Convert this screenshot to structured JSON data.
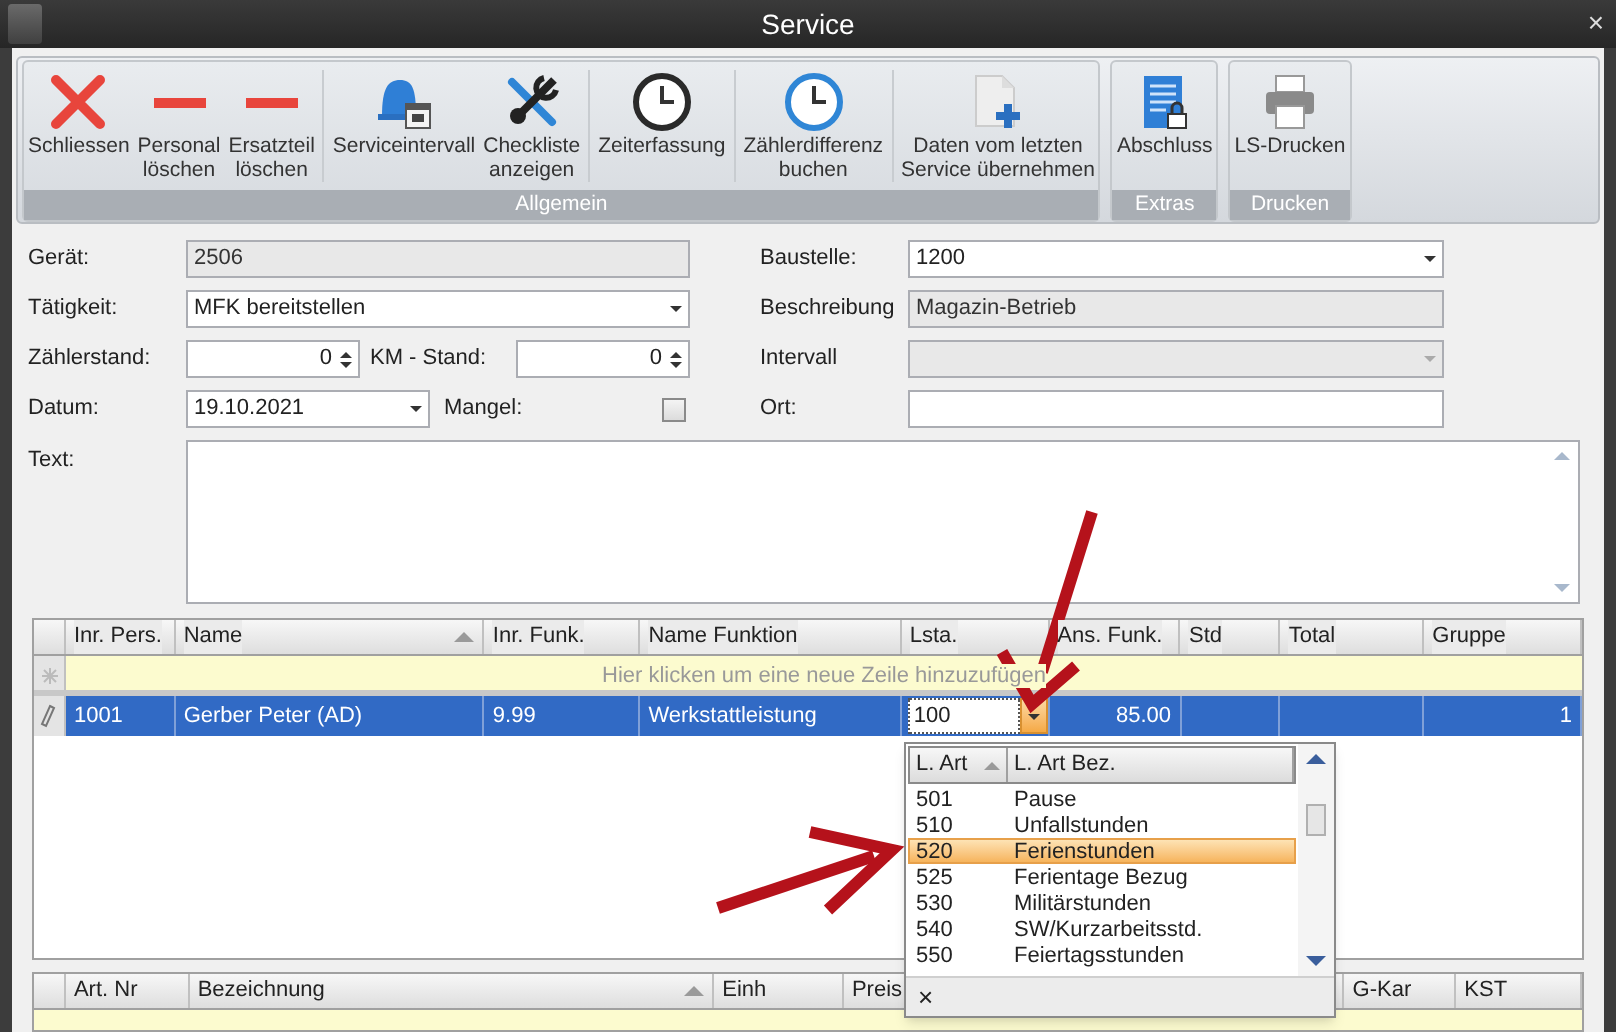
{
  "window": {
    "title": "Service",
    "close": "×"
  },
  "ribbon": {
    "groups": [
      {
        "label": "Allgemein",
        "buttons": [
          {
            "label": "Schliessen"
          },
          {
            "label": "Personal\nlöschen"
          },
          {
            "label": "Ersatzteil\nlöschen"
          },
          {
            "label": "Serviceintervall"
          },
          {
            "label": "Checkliste\nanzeigen"
          },
          {
            "label": "Zeiterfassung"
          },
          {
            "label": "Zählerdifferenz\nbuchen"
          },
          {
            "label": "Daten vom letzten\nService übernehmen"
          }
        ]
      },
      {
        "label": "Extras",
        "buttons": [
          {
            "label": "Abschluss"
          }
        ]
      },
      {
        "label": "Drucken",
        "buttons": [
          {
            "label": "LS-Drucken"
          }
        ]
      }
    ]
  },
  "form": {
    "left": [
      [
        {
          "kind": "label",
          "text": "Gerät:"
        },
        {
          "kind": "text",
          "value": "2506",
          "disabled": true
        }
      ],
      [
        {
          "kind": "label",
          "text": "Tätigkeit:"
        },
        {
          "kind": "combo",
          "value": "MFK bereitstellen",
          "disabled": false
        }
      ],
      [
        {
          "kind": "label",
          "text": "Zählerstand:"
        },
        {
          "kind": "spin",
          "value": "0"
        },
        {
          "kind": "label",
          "text": "KM - Stand:"
        },
        {
          "kind": "spin",
          "value": "0"
        }
      ],
      [
        {
          "kind": "label",
          "text": "Datum:"
        },
        {
          "kind": "combo",
          "value": "19.10.2021",
          "disabled": false
        },
        {
          "kind": "label",
          "text": "Mangel:"
        },
        {
          "kind": "checkbox",
          "checked": false
        }
      ]
    ],
    "right": [
      [
        {
          "kind": "label",
          "text": "Baustelle:"
        },
        {
          "kind": "combo",
          "value": "1200",
          "disabled": false
        }
      ],
      [
        {
          "kind": "label",
          "text": "Beschreibung"
        },
        {
          "kind": "text",
          "value": "Magazin-Betrieb",
          "disabled": true
        }
      ],
      [
        {
          "kind": "label",
          "text": "Intervall"
        },
        {
          "kind": "combo",
          "disabled": true
        }
      ],
      [
        {
          "kind": "label",
          "text": "Ort:"
        },
        {
          "kind": "text",
          "disabled": false
        }
      ]
    ],
    "text_label": "Text:"
  },
  "personal_grid": {
    "columns": [
      {
        "label": "Inr. Pers."
      },
      {
        "label": "Name",
        "sorted": true
      },
      {
        "label": "Inr. Funk."
      },
      {
        "label": "Name Funktion"
      },
      {
        "label": "Lsta."
      },
      {
        "label": "Ans. Funk."
      },
      {
        "label": "Std"
      },
      {
        "label": "Total"
      },
      {
        "label": "Gruppe"
      }
    ],
    "new_row_hint": "Hier klicken um eine neue Zeile hinzuzufügen",
    "rows": [
      {
        "selected": true,
        "editing": true,
        "cells": [
          "1001",
          "Gerber Peter (AD)",
          "9.99",
          "Werkstattleistung",
          "100",
          "85.00",
          "",
          "",
          "1"
        ]
      }
    ]
  },
  "lsta_dropdown": {
    "columns": [
      {
        "label": "L. Art",
        "sorted": true
      },
      {
        "label": "L. Art Bez."
      }
    ],
    "rows": [
      {
        "code": "501",
        "name": "Pause",
        "selected": false
      },
      {
        "code": "510",
        "name": "Unfallstunden",
        "selected": false
      },
      {
        "code": "520",
        "name": "Ferienstunden",
        "selected": true
      },
      {
        "code": "525",
        "name": "Ferientage Bezug",
        "selected": false
      },
      {
        "code": "530",
        "name": "Militärstunden",
        "selected": false
      },
      {
        "code": "540",
        "name": "SW/Kurzarbeitsstd.",
        "selected": false
      },
      {
        "code": "550",
        "name": "Feiertagsstunden",
        "selected": false
      }
    ],
    "clear": "×"
  },
  "parts_grid": {
    "columns": [
      {
        "label": "Art. Nr"
      },
      {
        "label": "Bezeichnung",
        "sorted": true
      },
      {
        "label": "Einh"
      },
      {
        "label": "Preis"
      },
      {
        "label": "G-Kar"
      },
      {
        "label": "KST"
      }
    ]
  }
}
